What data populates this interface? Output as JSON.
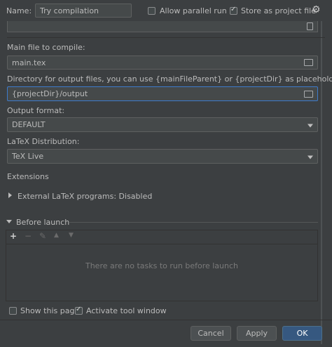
{
  "header": {
    "name_label": "Name:",
    "name_value": "Try compilation",
    "allow_parallel_label": "Allow parallel run",
    "allow_parallel_checked": false,
    "store_project_label": "Store as project file",
    "store_project_checked": true,
    "settings_icon": "gear-icon"
  },
  "form": {
    "main_file_label": "Main file to compile:",
    "main_file_value": "main.tex",
    "output_dir_label": "Directory for output files, you can use {mainFileParent} or {projectDir} as placeholders:",
    "output_dir_value": "{projectDir}/output",
    "output_format_label": "Output format:",
    "output_format_value": "DEFAULT",
    "latex_distribution_label": "LaTeX Distribution:",
    "latex_distribution_value": "TeX Live"
  },
  "extensions": {
    "section_label": "Extensions",
    "external_programs_label": "External LaTeX programs: Disabled"
  },
  "before_launch": {
    "section_label": "Before launch",
    "empty_text": "There are no tasks to run before launch"
  },
  "options": {
    "show_page_label": "Show this page",
    "show_page_checked": false,
    "activate_tool_label": "Activate tool window",
    "activate_tool_checked": true
  },
  "buttons": {
    "cancel": "Cancel",
    "apply": "Apply",
    "ok": "OK"
  },
  "colors": {
    "background": "#3c3f41",
    "field": "#45494a",
    "focus_border": "#3d7bcc",
    "primary_button": "#365880"
  }
}
